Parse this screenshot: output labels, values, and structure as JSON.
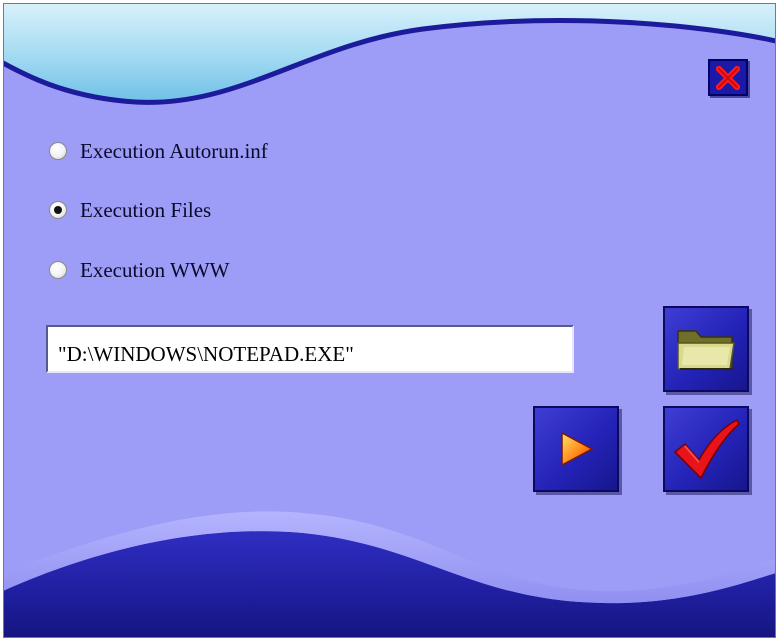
{
  "dialog": {
    "close_icon": "x-icon",
    "accent_color": "#2423b8",
    "background_color": "#9d9cf6"
  },
  "options": [
    {
      "label": "Execution Autorun.inf",
      "selected": false
    },
    {
      "label": "Execution Files",
      "selected": true
    },
    {
      "label": "Execution WWW",
      "selected": false
    }
  ],
  "path_field": {
    "value": "\"D:\\WINDOWS\\NOTEPAD.EXE\""
  },
  "buttons": {
    "browse_icon": "folder-icon",
    "run_icon": "play-arrow-icon",
    "ok_icon": "checkmark-icon"
  }
}
